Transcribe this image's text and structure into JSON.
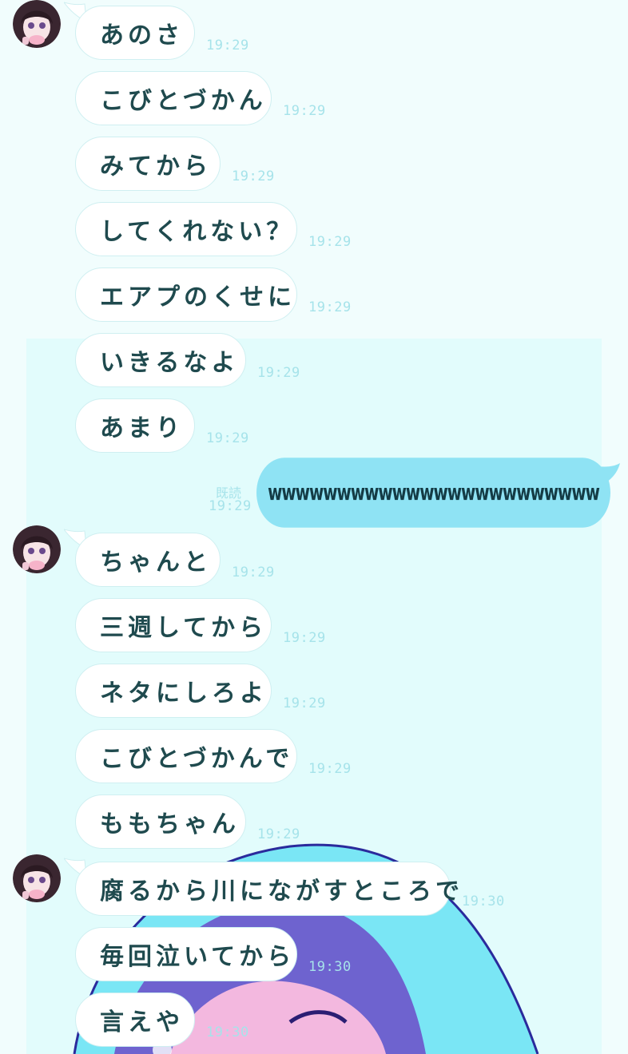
{
  "colors": {
    "background": "#f1fdfd",
    "panel": "#e2fcfc",
    "bubble_in": "#ffffff",
    "bubble_out": "#8fe3f4",
    "text": "#1f4a4e",
    "time": "#a6e3ea"
  },
  "avatar_icon": "girl-avatar-icon",
  "messages_block_1": [
    {
      "text": "あのさ",
      "time": "19:29"
    },
    {
      "text": "こびとづかん",
      "time": "19:29"
    },
    {
      "text": "みてから",
      "time": "19:29"
    },
    {
      "text": "してくれない？",
      "time": "19:29"
    },
    {
      "text": "エアプのくせに",
      "time": "19:29"
    },
    {
      "text": "いきるなよ",
      "time": "19:29"
    },
    {
      "text": "あまり",
      "time": "19:29"
    }
  ],
  "sent_message": {
    "read_label": "既読",
    "time": "19:29",
    "text": "wwwwwwwwwwwwwwwwwwwwwwww"
  },
  "messages_block_2": [
    {
      "text": "ちゃんと",
      "time": "19:29"
    },
    {
      "text": "三週してから",
      "time": "19:29"
    },
    {
      "text": "ネタにしろよ",
      "time": "19:29"
    },
    {
      "text": "こびとづかんで",
      "time": "19:29"
    },
    {
      "text": "ももちゃん",
      "time": "19:29"
    }
  ],
  "messages_block_3": [
    {
      "text": "腐るから川にながすところで",
      "time": "19:30"
    },
    {
      "text": "毎回泣いてから",
      "time": "19:30"
    },
    {
      "text": "言えや",
      "time": "19:30"
    }
  ]
}
